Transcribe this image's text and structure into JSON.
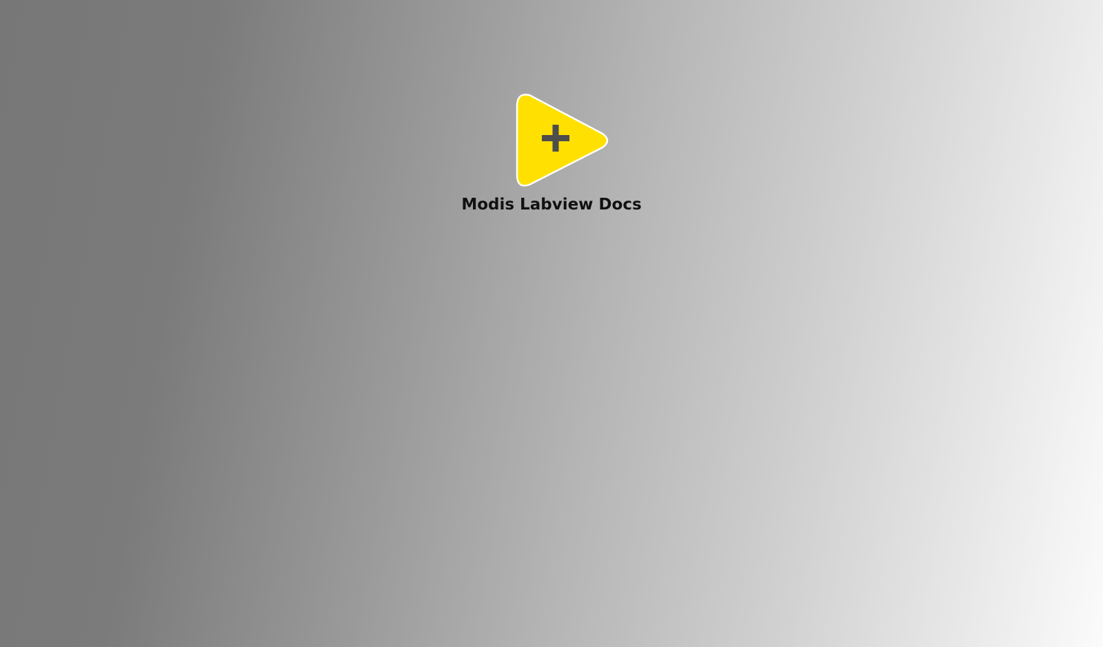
{
  "splash": {
    "title": "Modis Labview Docs",
    "logo": {
      "icon": "play-triangle-plus-icon",
      "fill_color": "#ffe000",
      "outline_color": "#ffffff",
      "symbol_color": "#4d4d4d"
    }
  },
  "colors": {
    "background_start": "#777777",
    "background_end": "#fbfbfb",
    "title_color": "#111111"
  }
}
